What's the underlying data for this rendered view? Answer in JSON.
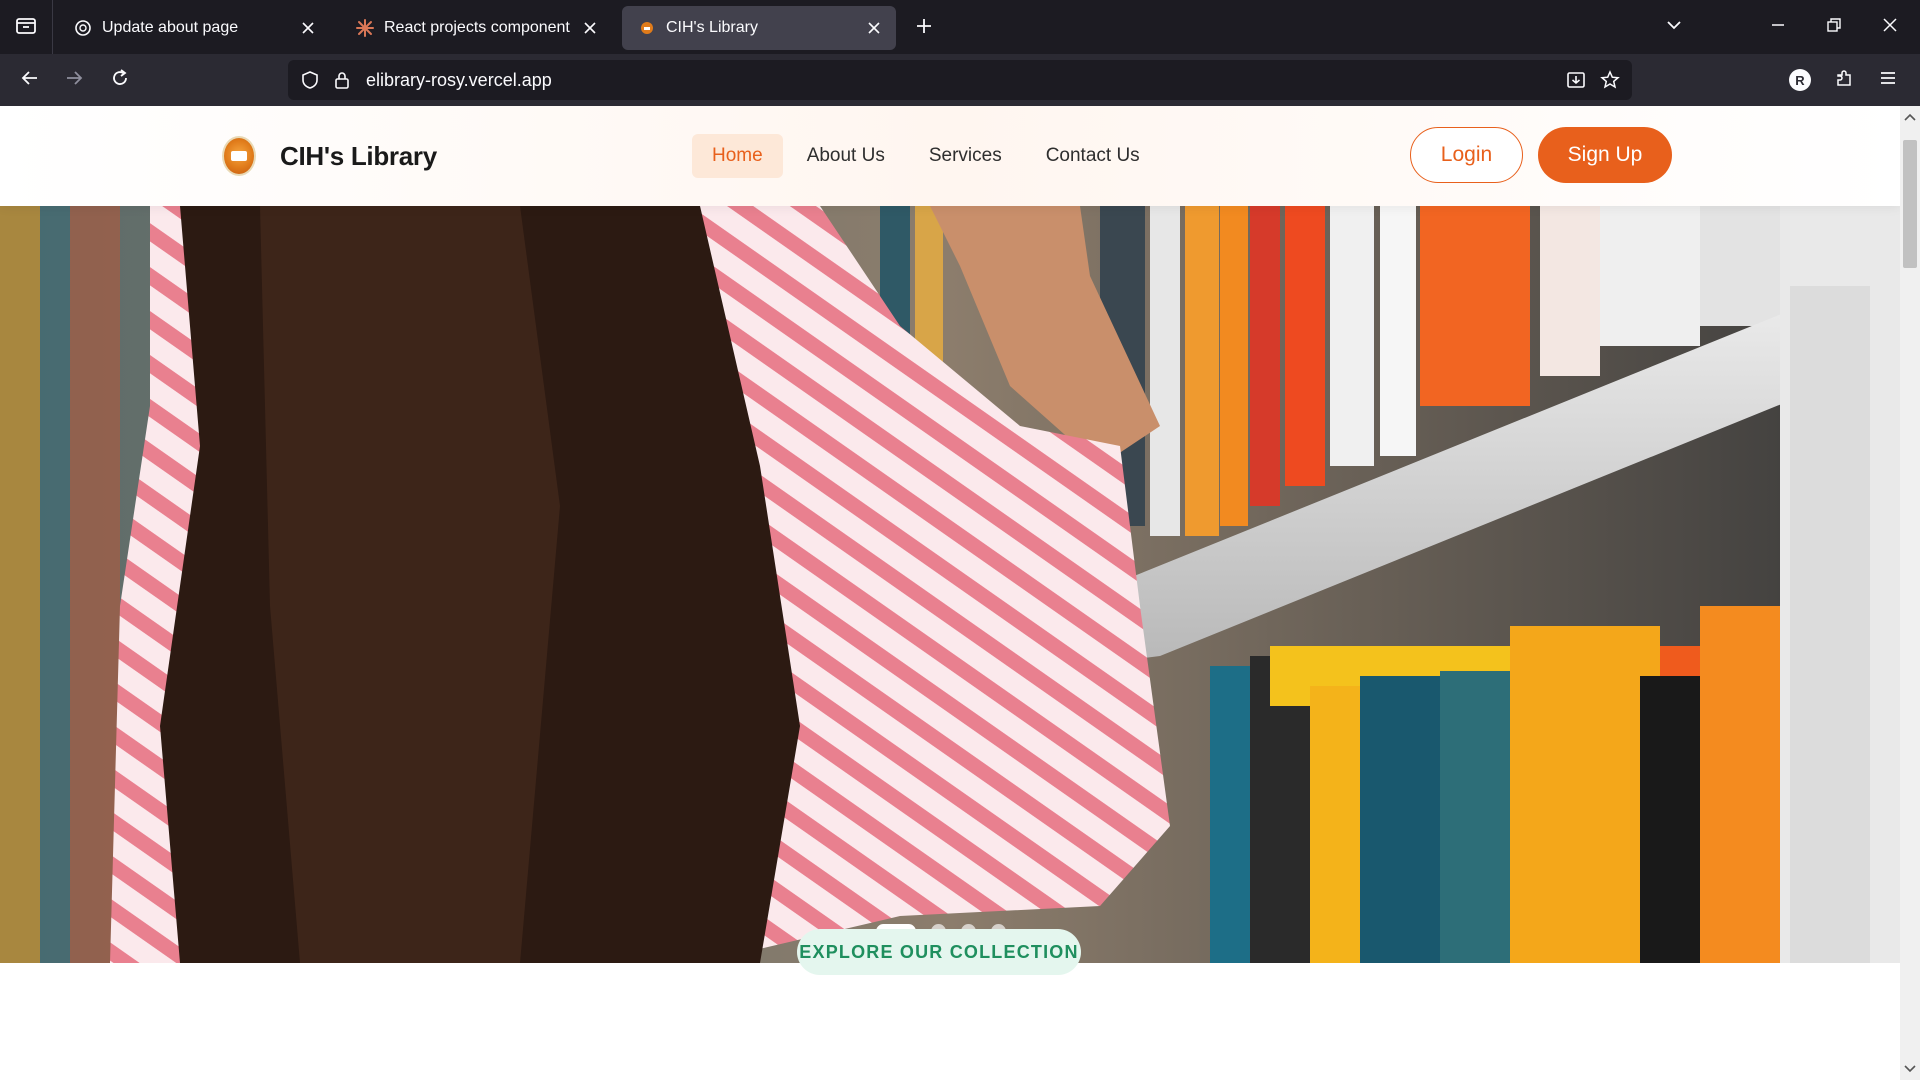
{
  "browser": {
    "tabs": [
      {
        "title": "Update about page",
        "icon": "openai-icon"
      },
      {
        "title": "React projects component with",
        "icon": "claude-icon"
      },
      {
        "title": "CIH's Library",
        "icon": "library-favicon"
      }
    ],
    "active_tab_index": 2,
    "url": "elibrary-rosy.vercel.app",
    "profile_initial": "R"
  },
  "site": {
    "brand_name": "CIH's Library",
    "nav": [
      {
        "label": "Home"
      },
      {
        "label": "About Us"
      },
      {
        "label": "Services"
      },
      {
        "label": "Contact Us"
      }
    ],
    "active_nav_index": 0,
    "login_label": "Login",
    "signup_label": "Sign Up",
    "accent_color": "#e8601c",
    "hero": {
      "slide_count": 4,
      "active_slide_index": 0,
      "image_subject": "woman in striped shirt reaching for books on a library shelf"
    },
    "section_badge": "EXPLORE OUR COLLECTION"
  }
}
